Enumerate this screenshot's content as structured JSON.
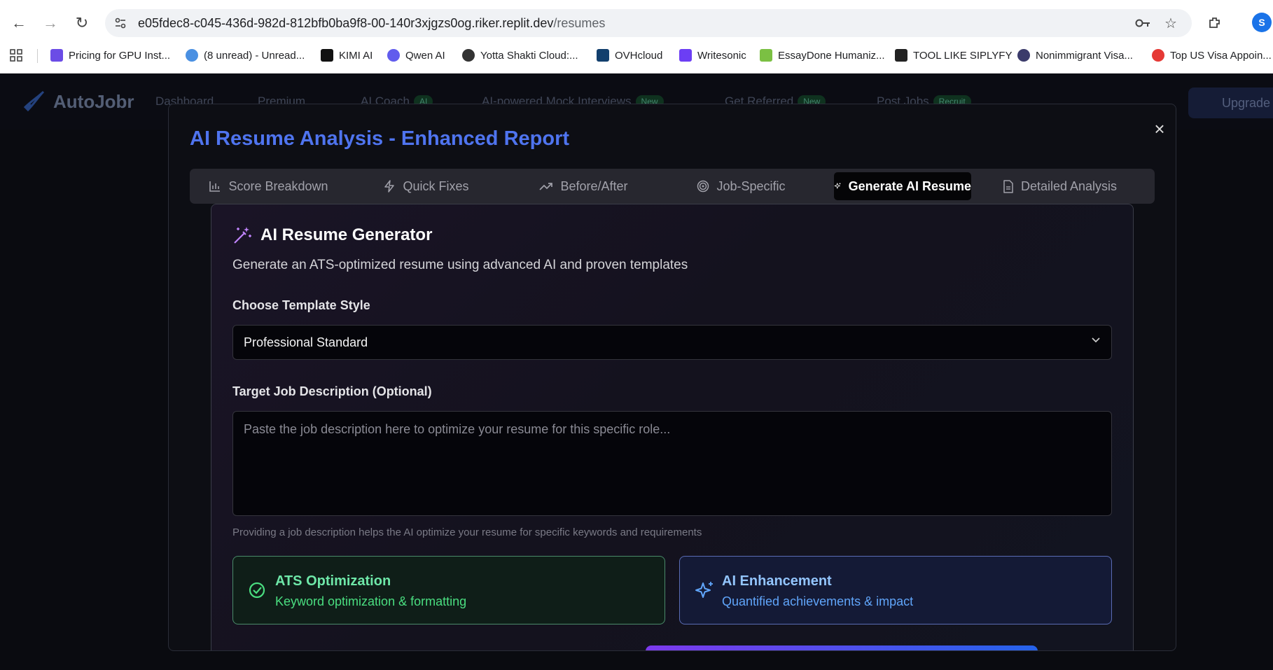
{
  "browser": {
    "url_host": "e05fdec8-c045-436d-982d-812bfb0ba9f8-00-140r3xjgzs0og.riker.replit.dev",
    "url_path": "/resumes",
    "profile_initial": "S",
    "bookmarks": [
      {
        "label": "Pricing for GPU Inst...",
        "color": "#6b4ce6"
      },
      {
        "label": "(8 unread) - Unread...",
        "color": "#4a90e2"
      },
      {
        "label": "KIMI AI",
        "color": "#111111"
      },
      {
        "label": "Qwen AI",
        "color": "#615ced"
      },
      {
        "label": "Yotta Shakti Cloud:...",
        "color": "#333333"
      },
      {
        "label": "OVHcloud",
        "color": "#123f6d"
      },
      {
        "label": "Writesonic",
        "color": "#6c3ef4"
      },
      {
        "label": "EssayDone Humaniz...",
        "color": "#7bc043"
      },
      {
        "label": "TOOL LIKE SIPLYFY",
        "color": "#222222"
      },
      {
        "label": "Nonimmigrant Visa...",
        "color": "#3b3b6b"
      },
      {
        "label": "Top US Visa Appoin...",
        "color": "#e53935"
      }
    ]
  },
  "app": {
    "logo": "AutoJobr",
    "nav": [
      {
        "label": "Dashboard",
        "badge": ""
      },
      {
        "label": "Premium",
        "badge": ""
      },
      {
        "label": "AI Coach",
        "badge": "AI"
      },
      {
        "label": "AI-powered Mock Interviews",
        "badge": "New"
      },
      {
        "label": "Get Referred",
        "badge": "New"
      },
      {
        "label": "Post Jobs",
        "badge": "Recruit"
      }
    ],
    "upgrade_label": "Upgrade"
  },
  "modal": {
    "title": "AI Resume Analysis - Enhanced Report",
    "tabs": [
      {
        "label": "Score Breakdown",
        "icon": "bar-chart-icon"
      },
      {
        "label": "Quick Fixes",
        "icon": "lightning-icon"
      },
      {
        "label": "Before/After",
        "icon": "trending-up-icon"
      },
      {
        "label": "Job-Specific",
        "icon": "target-icon"
      },
      {
        "label": "Generate AI Resume",
        "icon": "sparkles-icon",
        "active": true
      },
      {
        "label": "Detailed Analysis",
        "icon": "document-icon"
      }
    ],
    "generator": {
      "title": "AI Resume Generator",
      "subtitle": "Generate an ATS-optimized resume using advanced AI and proven templates",
      "template_label": "Choose Template Style",
      "template_value": "Professional Standard",
      "job_desc_label": "Target Job Description (Optional)",
      "job_desc_placeholder": "Paste the job description here to optimize your resume for this specific role...",
      "help_text": "Providing a job description helps the AI optimize your resume for specific keywords and requirements",
      "features": [
        {
          "title": "ATS Optimization",
          "desc": "Keyword optimization & formatting"
        },
        {
          "title": "AI Enhancement",
          "desc": "Quantified achievements & impact"
        }
      ]
    }
  }
}
